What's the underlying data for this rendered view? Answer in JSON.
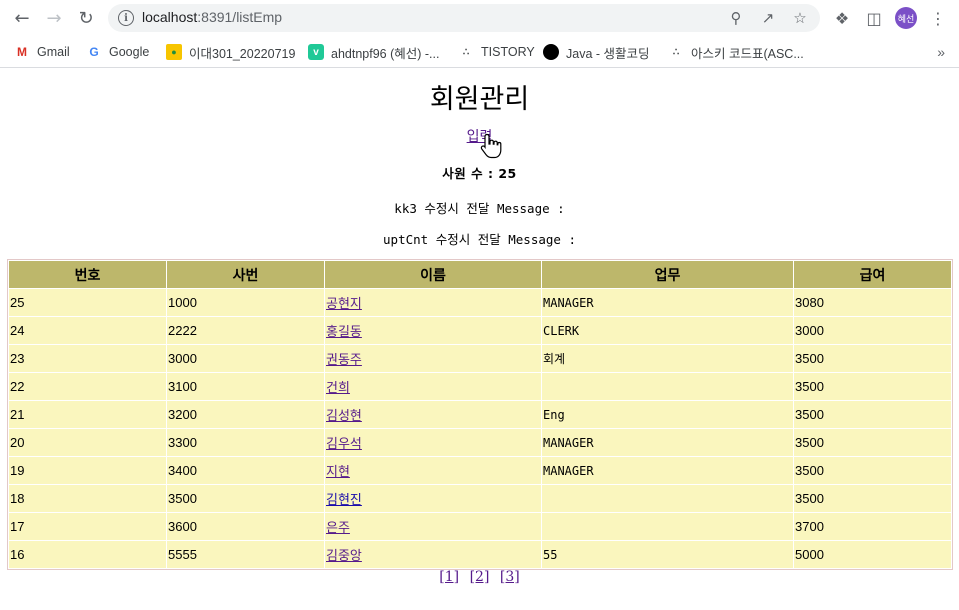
{
  "browser": {
    "url_host": "localhost",
    "url_port_path": ":8391/listEmp",
    "avatar_label": "혜선",
    "bookmarks": [
      {
        "label": "Gmail",
        "icon": "gmail-icon"
      },
      {
        "label": "Google",
        "icon": "google-icon"
      },
      {
        "label": "이대301_20220719",
        "icon": "classroom-icon"
      },
      {
        "label": "ahdtnpf96 (혜선) -...",
        "icon": "velog-icon"
      },
      {
        "label": "TISTORY",
        "icon": "tistory-icon"
      },
      {
        "label": "Java - 생활코딩",
        "icon": "circle-icon"
      },
      {
        "label": "아스키 코드표(ASC...",
        "icon": "tistory-icon"
      }
    ]
  },
  "page": {
    "title": "회원관리",
    "insert_link": "입력",
    "count_text": "사원 수 : 25",
    "msg1": "kk3 수정시 전달 Message :",
    "msg2": "uptCnt 수정시 전달 Message :"
  },
  "table": {
    "headers": [
      "번호",
      "사번",
      "이름",
      "업무",
      "급여"
    ],
    "rows": [
      {
        "no": "25",
        "empno": "1000",
        "name": "공현지",
        "job": "MANAGER",
        "sal": "3080",
        "visited": false
      },
      {
        "no": "24",
        "empno": "2222",
        "name": "홍길동",
        "job": "CLERK",
        "sal": "3000",
        "visited": false
      },
      {
        "no": "23",
        "empno": "3000",
        "name": "권동주",
        "job": "회계",
        "sal": "3500",
        "visited": false
      },
      {
        "no": "22",
        "empno": "3100",
        "name": "건희",
        "job": "",
        "sal": "3500",
        "visited": false
      },
      {
        "no": "21",
        "empno": "3200",
        "name": "김성현",
        "job": "Eng",
        "sal": "3500",
        "visited": false
      },
      {
        "no": "20",
        "empno": "3300",
        "name": "김우석",
        "job": "MANAGER",
        "sal": "3500",
        "visited": false
      },
      {
        "no": "19",
        "empno": "3400",
        "name": "지현",
        "job": "MANAGER",
        "sal": "3500",
        "visited": false
      },
      {
        "no": "18",
        "empno": "3500",
        "name": "김현진",
        "job": "",
        "sal": "3500",
        "visited": true
      },
      {
        "no": "17",
        "empno": "3600",
        "name": "은주",
        "job": "",
        "sal": "3700",
        "visited": false
      },
      {
        "no": "16",
        "empno": "5555",
        "name": "김중앙",
        "job": "55",
        "sal": "5000",
        "visited": false
      }
    ]
  },
  "pager": [
    "[1]",
    "[2]",
    "[3]"
  ]
}
